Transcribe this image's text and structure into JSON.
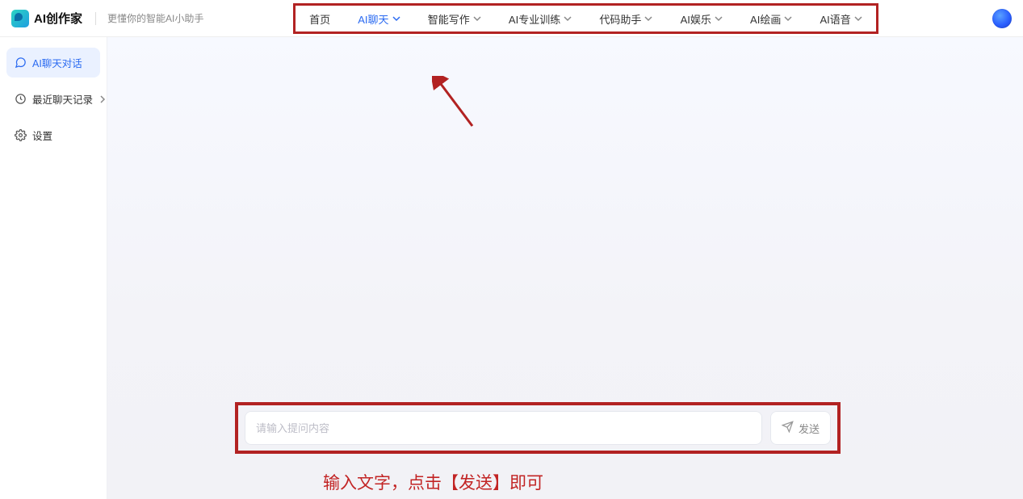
{
  "header": {
    "product_name": "AI创作家",
    "tagline": "更懂你的智能AI小助手",
    "nav": [
      {
        "label": "首页",
        "dropdown": false,
        "active": false
      },
      {
        "label": "AI聊天",
        "dropdown": true,
        "active": true
      },
      {
        "label": "智能写作",
        "dropdown": true,
        "active": false
      },
      {
        "label": "AI专业训练",
        "dropdown": true,
        "active": false
      },
      {
        "label": "代码助手",
        "dropdown": true,
        "active": false
      },
      {
        "label": "AI娱乐",
        "dropdown": true,
        "active": false
      },
      {
        "label": "AI绘画",
        "dropdown": true,
        "active": false
      },
      {
        "label": "AI语音",
        "dropdown": true,
        "active": false
      }
    ]
  },
  "sidebar": {
    "items": [
      {
        "icon": "chat-icon",
        "label": "AI聊天对话",
        "active": true,
        "expandable": false
      },
      {
        "icon": "clock-icon",
        "label": "最近聊天记录",
        "active": false,
        "expandable": true
      },
      {
        "icon": "gear-icon",
        "label": "设置",
        "active": false,
        "expandable": false
      }
    ]
  },
  "chat": {
    "input_placeholder": "请输入提问内容",
    "send_label": "发送"
  },
  "annotation": {
    "instruction_text": "输入文字，点击【发送】即可",
    "frame_color": "#b22222"
  }
}
